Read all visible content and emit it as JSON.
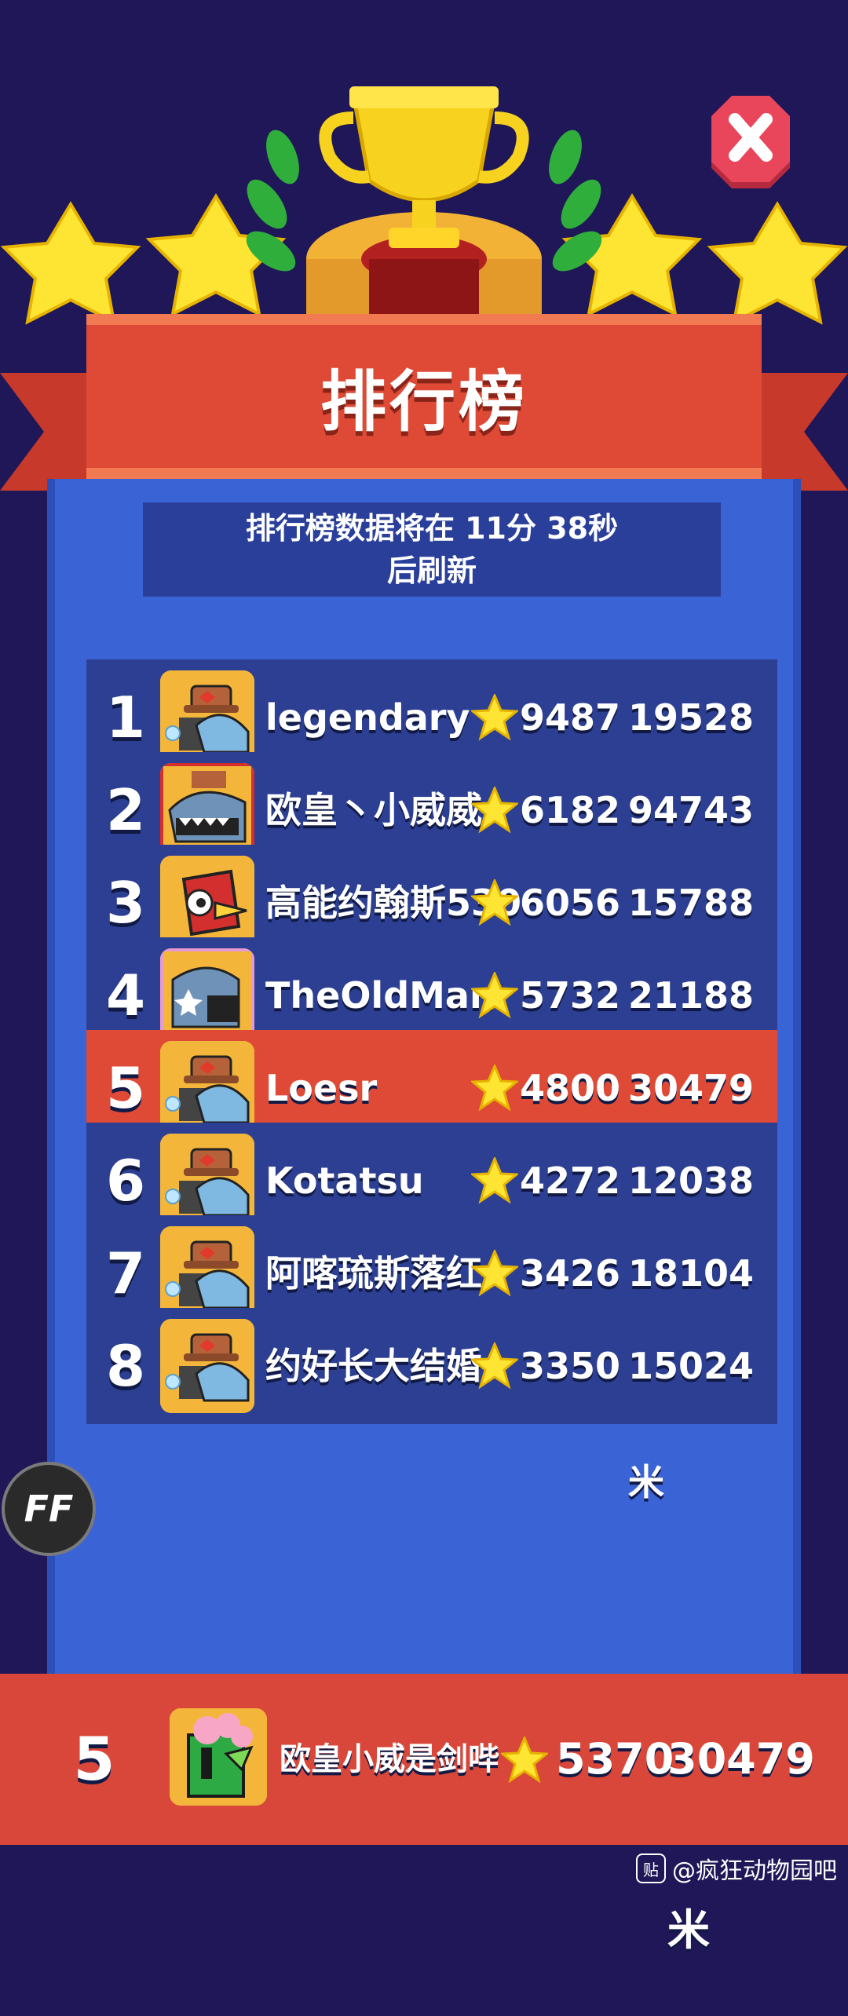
{
  "board": {
    "title": "排行榜",
    "refresh_line1": "排行榜数据将在 11分 38秒",
    "refresh_line2": "后刷新"
  },
  "rows": [
    {
      "rank": "1",
      "name": "legendary",
      "score": "9487",
      "distance": "19528米",
      "avatar": "cowboy-shark"
    },
    {
      "rank": "2",
      "name": "欧皇丶小威威",
      "score": "6182",
      "distance": "94743米",
      "avatar": "red-frame-shark"
    },
    {
      "rank": "3",
      "name": "高能约翰斯530",
      "score": "6056",
      "distance": "15788米",
      "avatar": "red-bird"
    },
    {
      "rank": "4",
      "name": "TheOldMan",
      "score": "5732",
      "distance": "21188米",
      "avatar": "pink-frame-croc"
    },
    {
      "rank": "5",
      "name": "Loesr",
      "score": "4800",
      "distance": "30479米",
      "avatar": "cowboy-shark",
      "highlight": true
    },
    {
      "rank": "6",
      "name": "Kotatsu",
      "score": "4272",
      "distance": "12038米",
      "avatar": "cowboy-shark"
    },
    {
      "rank": "7",
      "name": "阿喀琉斯落红",
      "score": "3426",
      "distance": "18104米",
      "avatar": "cowboy-shark"
    },
    {
      "rank": "8",
      "name": "约好长大结婚",
      "score": "3350",
      "distance": "15024米",
      "avatar": "cowboy-shark"
    }
  ],
  "me": {
    "rank": "5",
    "name": "欧皇小威是剑哔",
    "score": "5370",
    "distance": "30479米",
    "avatar": "green-tree-creature"
  },
  "float_button": {
    "label": "FF"
  },
  "watermark": {
    "logo": "贴",
    "text": "@疯狂动物园吧"
  },
  "colors": {
    "background": "#1f1758",
    "panel": "#3a63d6",
    "row": "#2c3f93",
    "highlight_row": "#de4a35",
    "ribbon": "#de4a35",
    "trophy": "#f7d21e",
    "star": "#ffe533",
    "close_button": "#e9455b"
  }
}
